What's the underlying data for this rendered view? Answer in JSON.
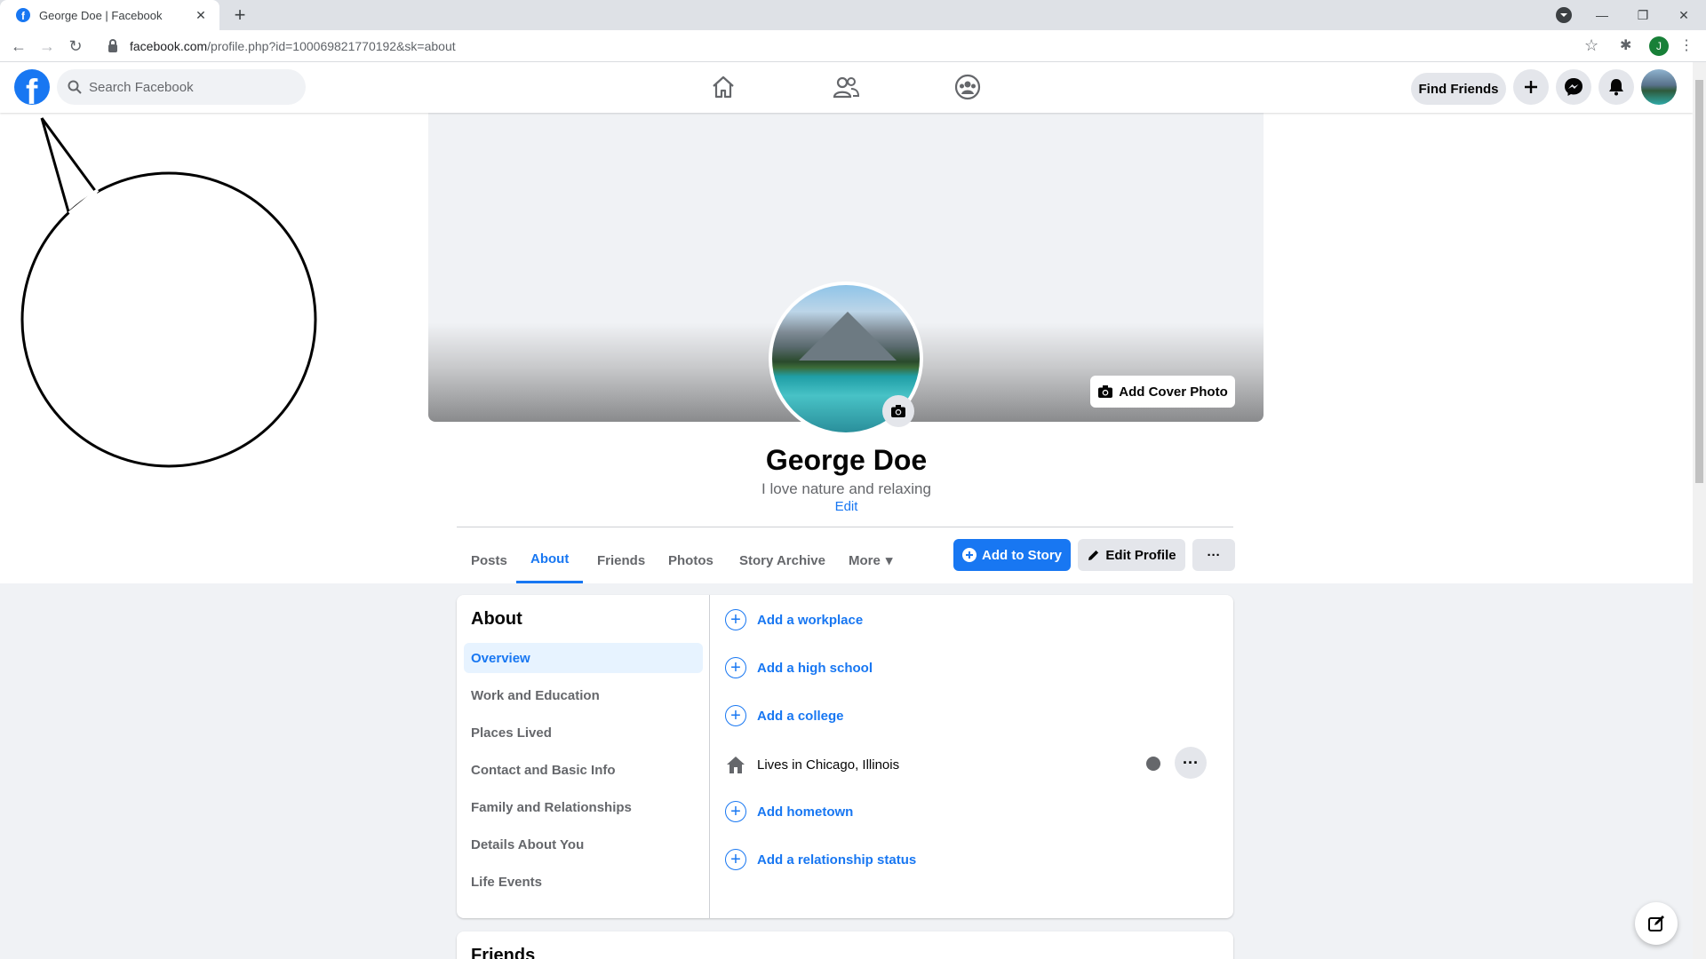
{
  "browser": {
    "tab_title": "George Doe | Facebook",
    "tab_close": "✕",
    "new_tab": "+",
    "url_domain": "facebook.com",
    "url_path": "/profile.php?id=100069821770192&sk=about",
    "profile_initial": "J",
    "win_min": "—",
    "win_max": "❐",
    "win_close": "✕",
    "back": "←",
    "forward": "→",
    "reload": "↻",
    "star": "☆",
    "ext": "✱",
    "menu": "⋮"
  },
  "header": {
    "logo_letter": "f",
    "search_placeholder": "Search Facebook",
    "find_friends": "Find Friends"
  },
  "profile": {
    "name": "George Doe",
    "bio": "I love nature and relaxing",
    "edit_bio": "Edit",
    "add_cover_photo": "Add Cover Photo",
    "tabs": [
      {
        "label": "Posts"
      },
      {
        "label": "About"
      },
      {
        "label": "Friends"
      },
      {
        "label": "Photos"
      },
      {
        "label": "Story Archive"
      },
      {
        "label": "More"
      }
    ],
    "more_caret": "▾",
    "add_to_story": "Add to Story",
    "edit_profile": "Edit Profile",
    "overflow": "···"
  },
  "about": {
    "title": "About",
    "nav": [
      {
        "label": "Overview"
      },
      {
        "label": "Work and Education"
      },
      {
        "label": "Places Lived"
      },
      {
        "label": "Contact and Basic Info"
      },
      {
        "label": "Family and Relationships"
      },
      {
        "label": "Details About You"
      },
      {
        "label": "Life Events"
      }
    ],
    "rows": {
      "workplace": "Add a workplace",
      "high_school": "Add a high school",
      "college": "Add a college",
      "lives_in_prefix": "Lives in ",
      "lives_in_city": "Chicago, Illinois",
      "hometown": "Add hometown",
      "relationship": "Add a relationship status"
    },
    "plus": "+",
    "row_more": "···"
  },
  "friends_section": {
    "title": "Friends"
  },
  "colors": {
    "brand": "#1877f2",
    "background": "#f0f2f5",
    "active_nav_bg": "#e7f3ff"
  }
}
